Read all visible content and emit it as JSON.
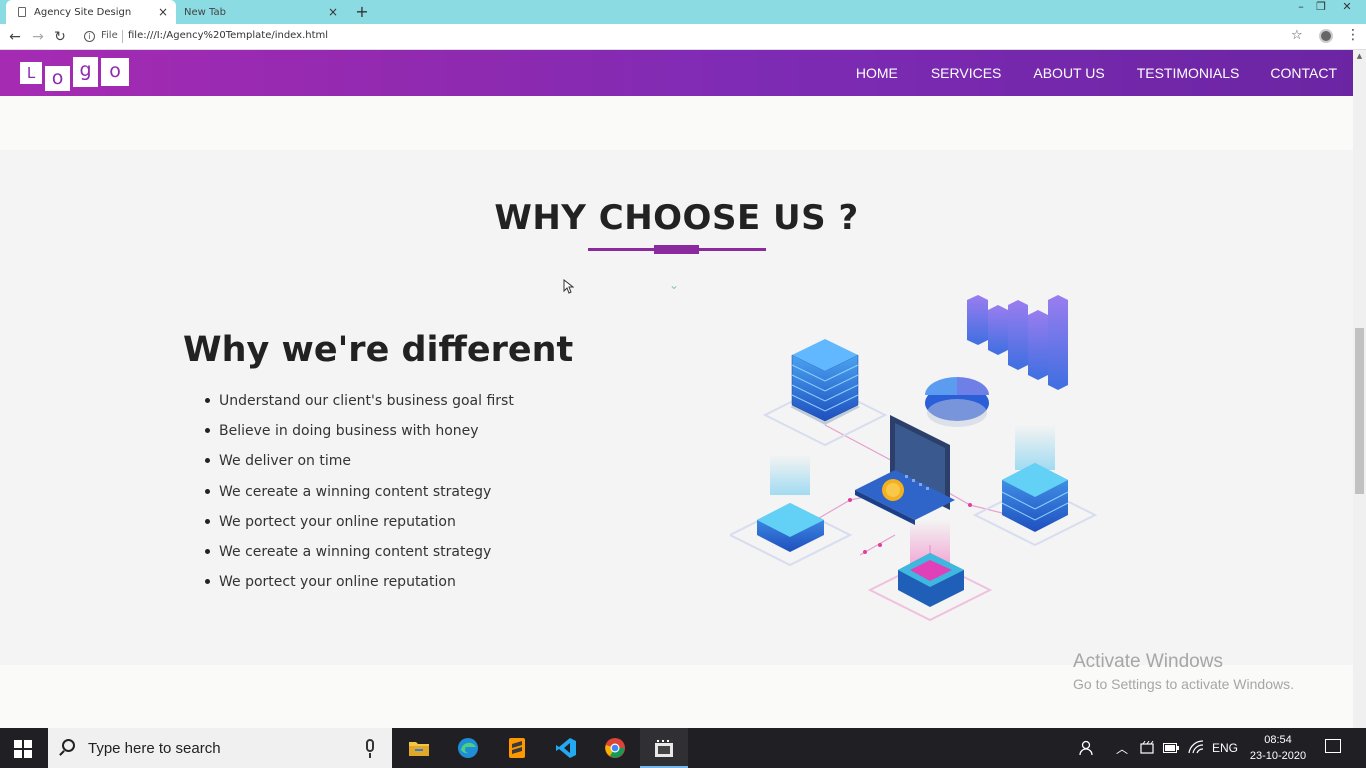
{
  "browser": {
    "tabs": [
      {
        "title": "Agency Site Design",
        "close": "×"
      },
      {
        "title": "New Tab",
        "close": "×"
      }
    ],
    "new_tab": "+",
    "window_controls": [
      "–",
      "❐",
      "✕"
    ],
    "back": "←",
    "forward": "→",
    "reload": "↻",
    "info": "i",
    "file_label": "File",
    "url": "file:///I:/Agency%20Template/index.html",
    "bookmark_icon": "☆",
    "menu_icon": "⋮"
  },
  "site": {
    "logo_letters": [
      "L",
      "o",
      "g",
      "o"
    ],
    "nav": [
      "HOME",
      "SERVICES",
      "ABOUT US",
      "TESTIMONIALS",
      "CONTACT"
    ],
    "section_title": "WHY CHOOSE US ?",
    "chevron": "⌄",
    "subheading": "Why we're different",
    "features": [
      "Understand our client's business goal first",
      "Believe in doing business with honey",
      "We deliver on time",
      "We cereate a winning content strategy",
      "We portect your online reputation",
      "We cereate a winning content strategy",
      "We portect your online reputation"
    ],
    "accent_color": "#8a2a9e"
  },
  "watermark": {
    "line1": "Activate Windows",
    "line2": "Go to Settings to activate Windows."
  },
  "taskbar": {
    "search_placeholder": "Type here to search",
    "apps": [
      "file-explorer",
      "edge",
      "sublime-text",
      "vscode",
      "chrome",
      "video-editor"
    ],
    "language": "ENG",
    "time": "08:54",
    "date": "23-10-2020"
  }
}
